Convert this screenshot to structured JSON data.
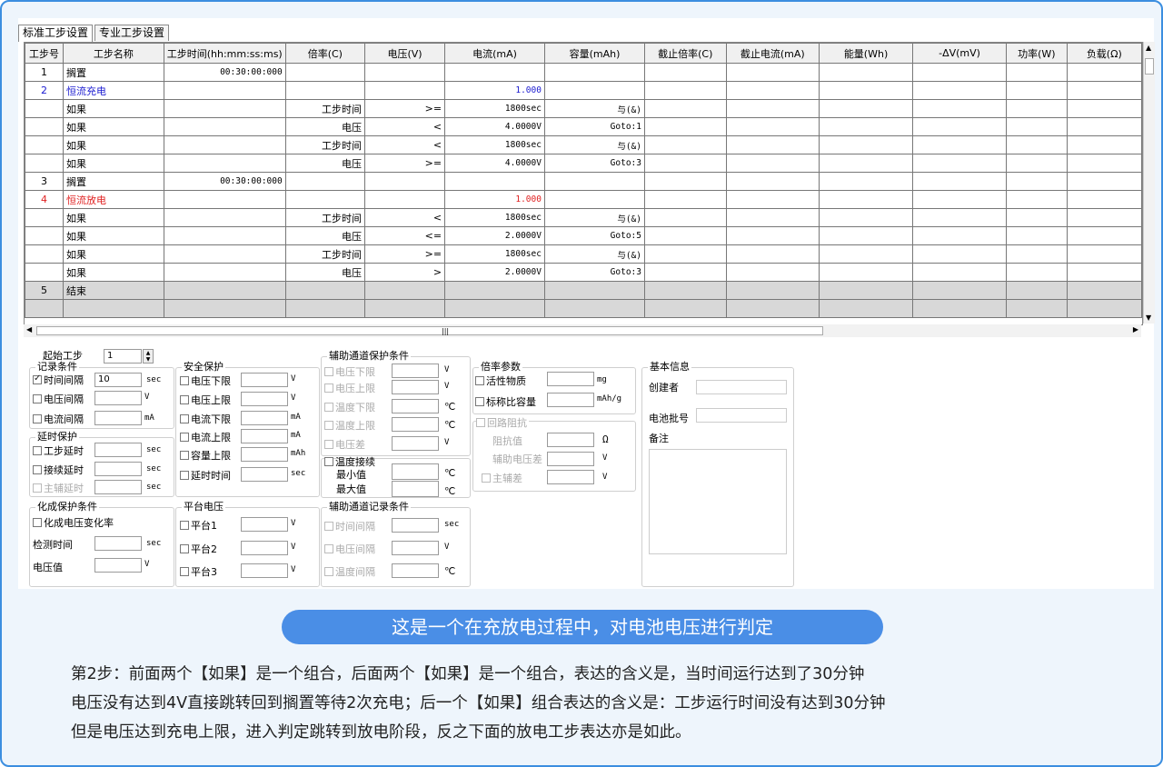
{
  "tabs": [
    "标准工步设置",
    "专业工步设置"
  ],
  "columns": [
    "工步号",
    "工步名称",
    "工步时间(hh:mm:ss:ms)",
    "倍率(C)",
    "电压(V)",
    "电流(mA)",
    "容量(mAh)",
    "截止倍率(C)",
    "截止电流(mA)",
    "能量(Wh)",
    "-ΔV(mV)",
    "功率(W)",
    "负载(Ω)"
  ],
  "rows": [
    {
      "no": "1",
      "name": "搁置",
      "time": "00:30:00:000",
      "rate": "",
      "volt": "",
      "cur": "",
      "cap": "",
      "type": "step"
    },
    {
      "no": "2",
      "name": "恒流充电",
      "time": "",
      "rate": "",
      "volt": "",
      "cur": "1.000",
      "cap": "",
      "type": "charge"
    },
    {
      "no": "",
      "name": "如果",
      "time": "",
      "rate": "工步时间",
      "volt": ">=",
      "cur": "1800sec",
      "cap": "与(&)",
      "type": "if"
    },
    {
      "no": "",
      "name": "如果",
      "time": "",
      "rate": "电压",
      "volt": "<",
      "cur": "4.0000V",
      "cap": "Goto:1",
      "type": "if"
    },
    {
      "no": "",
      "name": "如果",
      "time": "",
      "rate": "工步时间",
      "volt": "<",
      "cur": "1800sec",
      "cap": "与(&)",
      "type": "if"
    },
    {
      "no": "",
      "name": "如果",
      "time": "",
      "rate": "电压",
      "volt": ">=",
      "cur": "4.0000V",
      "cap": "Goto:3",
      "type": "if"
    },
    {
      "no": "3",
      "name": "搁置",
      "time": "00:30:00:000",
      "rate": "",
      "volt": "",
      "cur": "",
      "cap": "",
      "type": "step"
    },
    {
      "no": "4",
      "name": "恒流放电",
      "time": "",
      "rate": "",
      "volt": "",
      "cur": "1.000",
      "cap": "",
      "type": "discharge"
    },
    {
      "no": "",
      "name": "如果",
      "time": "",
      "rate": "工步时间",
      "volt": "<",
      "cur": "1800sec",
      "cap": "与(&)",
      "type": "if"
    },
    {
      "no": "",
      "name": "如果",
      "time": "",
      "rate": "电压",
      "volt": "<=",
      "cur": "2.0000V",
      "cap": "Goto:5",
      "type": "if"
    },
    {
      "no": "",
      "name": "如果",
      "time": "",
      "rate": "工步时间",
      "volt": ">=",
      "cur": "1800sec",
      "cap": "与(&)",
      "type": "if"
    },
    {
      "no": "",
      "name": "如果",
      "time": "",
      "rate": "电压",
      "volt": ">",
      "cur": "2.0000V",
      "cap": "Goto:3",
      "type": "if"
    },
    {
      "no": "5",
      "name": "结束",
      "time": "",
      "rate": "",
      "volt": "",
      "cur": "",
      "cap": "",
      "type": "end"
    },
    {
      "no": "",
      "name": "",
      "time": "",
      "rate": "",
      "volt": "",
      "cur": "",
      "cap": "",
      "type": "blank"
    }
  ],
  "start": {
    "label": "起始工步",
    "value": "1"
  },
  "record": {
    "title": "记录条件",
    "time": "时间间隔",
    "time_value": "10",
    "time_unit": "sec",
    "volt": "电压间隔",
    "volt_unit": "V",
    "cur": "电流间隔",
    "cur_unit": "mA"
  },
  "delay": {
    "title": "延时保护",
    "step": "工步延时",
    "cont": "接续延时",
    "main": "主辅延时",
    "unit": "sec"
  },
  "formation": {
    "title": "化成保护条件",
    "rate": "化成电压变化率",
    "detect": "检测时间",
    "detect_unit": "sec",
    "volt": "电压值",
    "volt_unit": "V"
  },
  "safety": {
    "title": "安全保护",
    "vlow": "电压下限",
    "vhigh": "电压上限",
    "ilow": "电流下限",
    "ihigh": "电流上限",
    "cap": "容量上限",
    "delay": "延时时间",
    "u_v": "V",
    "u_ma": "mA",
    "u_mah": "mAh",
    "u_sec": "sec"
  },
  "platform": {
    "title": "平台电压",
    "p1": "平台1",
    "p2": "平台2",
    "p3": "平台3",
    "unit": "V"
  },
  "aux": {
    "title": "辅助通道保护条件",
    "vlow": "电压下限",
    "vhigh": "电压上限",
    "tlow": "温度下限",
    "thigh": "温度上限",
    "vdiff": "电压差",
    "u_v": "V",
    "u_c": "℃",
    "temp": "温度接续",
    "min": "最小值",
    "max": "最大值"
  },
  "auxrec": {
    "title": "辅助通道记录条件",
    "time": "时间间隔",
    "volt": "电压间隔",
    "temp": "温度间隔",
    "u_sec": "sec",
    "u_v": "V",
    "u_c": "℃"
  },
  "ratio": {
    "title": "倍率参数",
    "active": "活性物质",
    "u_mg": "mg",
    "spec": "标称比容量",
    "u_mahg": "mAh/g"
  },
  "loop": {
    "title": "回路阻抗",
    "imp": "阻抗值",
    "u_ohm": "Ω",
    "auxv": "辅助电压差",
    "u_v": "V",
    "main": "主辅差",
    "u_v2": "V"
  },
  "info": {
    "title": "基本信息",
    "creator": "创建者",
    "batch": "电池批号",
    "note": "备注"
  },
  "banner": "这是一个在充放电过程中，对电池电压进行判定",
  "description": [
    "第2步：前面两个【如果】是一个组合，后面两个【如果】是一个组合，表达的含义是，当时间运行达到了30分钟",
    "电压没有达到4V直接跳转回到搁置等待2次充电；后一个【如果】组合表达的含义是：工步运行时间没有达到30分钟",
    "但是电压达到充电上限，进入判定跳转到放电阶段，反之下面的放电工步表达亦是如此。"
  ]
}
